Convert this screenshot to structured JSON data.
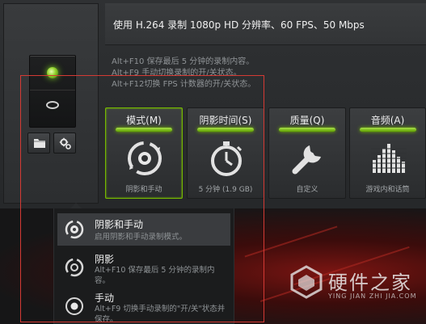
{
  "header": {
    "status_text": "使用 H.264 录制 1080p HD 分辨率、60 FPS、50 Mbps"
  },
  "hints": [
    "Alt+F10 保存最后 5 分钟的录制内容。",
    "Alt+F9 手动切换录制的开/关状态。",
    "Alt+F12切换 FPS 计数器的开/关状态。"
  ],
  "toolbar": {
    "folder_icon": "folder-icon",
    "settings_icon": "gear-icon"
  },
  "tiles": [
    {
      "label": "模式(M)",
      "value": "阴影和手动",
      "icon": "mode-cycle-icon",
      "active": true
    },
    {
      "label": "阴影时间(S)",
      "value": "5 分钟 (1.9 GB)",
      "icon": "stopwatch-icon",
      "active": false
    },
    {
      "label": "质量(Q)",
      "value": "自定义",
      "icon": "wrench-icon",
      "active": false
    },
    {
      "label": "音频(A)",
      "value": "游戏内和话筒",
      "icon": "audio-level-icon",
      "active": false
    }
  ],
  "mode_menu": [
    {
      "title": "阴影和手动",
      "desc": "启用阴影和手动录制模式。",
      "selected": true
    },
    {
      "title": "阴影",
      "desc": "Alt+F10 保存最后 5 分钟的录制内容。",
      "selected": false
    },
    {
      "title": "手动",
      "desc": "Alt+F9 切换手动录制的\"开/关\"状态并保存。",
      "selected": false
    }
  ],
  "watermark": {
    "title": "硬件之家",
    "subtitle": "YING JIAN ZHI JIA.COM"
  },
  "colors": {
    "accent_green": "#76b900",
    "highlight_red": "#d43a34"
  }
}
